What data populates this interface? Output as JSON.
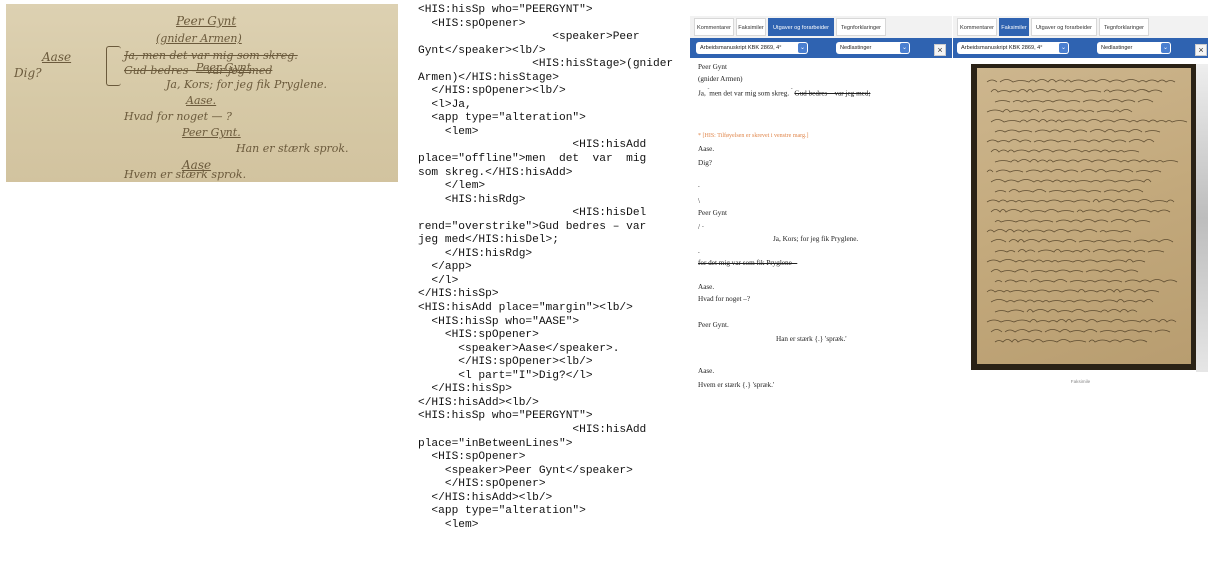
{
  "manuscript": {
    "lines": [
      {
        "text": "Peer Gynt",
        "style": "ul"
      },
      {
        "text": "(gnider Armen)",
        "style": "ul"
      },
      {
        "text": "Aase",
        "style": "ul"
      },
      {
        "text": "Ja, men det var mig som skreg.",
        "style": "strike"
      },
      {
        "text": "Dig?",
        "style": ""
      },
      {
        "text": "Gud bedres — var jeg med",
        "style": "strike"
      },
      {
        "text": "Peer Gynt",
        "style": "ul"
      },
      {
        "text": "Ja, Kors; for jeg fik Pryglene.",
        "style": ""
      },
      {
        "text": "Aase.",
        "style": "ul"
      },
      {
        "text": "Hvad for noget — ?",
        "style": ""
      },
      {
        "text": "Peer Gynt.",
        "style": "ul"
      },
      {
        "text": "Han er stærk sprok.",
        "style": ""
      },
      {
        "text": "Aase",
        "style": "ul"
      },
      {
        "text": "Hvem er stærk sprok.",
        "style": ""
      }
    ]
  },
  "xml_lines": [
    "<HIS:hisSp who=\"PEERGYNT\">",
    "  <HIS:spOpener>",
    "                    <speaker>Peer",
    "Gynt</speaker><lb/>",
    "                 <HIS:hisStage>(gnider",
    "Armen)</HIS:hisStage>",
    "  </HIS:spOpener><lb/>",
    "  <l>Ja,",
    "  <app type=\"alteration\">",
    "    <lem>",
    "                       <HIS:hisAdd",
    "place=\"offline\">men  det  var  mig",
    "som skreg.</HIS:hisAdd>",
    "    </lem>",
    "    <HIS:hisRdg>",
    "                       <HIS:hisDel",
    "rend=\"overstrike\">Gud bedres – var",
    "jeg med</HIS:hisDel>;",
    "    </HIS:hisRdg>",
    "  </app>",
    "  </l>",
    "</HIS:hisSp>",
    "<HIS:hisAdd place=\"margin\"><lb/>",
    "  <HIS:hisSp who=\"AASE\">",
    "    <HIS:spOpener>",
    "      <speaker>Aase</speaker>.",
    "      </HIS:spOpener><lb/>",
    "      <l part=\"I\">Dig?</l>",
    "  </HIS:hisSp>",
    "</HIS:hisAdd><lb/>",
    "<HIS:hisSp who=\"PEERGYNT\">",
    "                       <HIS:hisAdd",
    "place=\"inBetweenLines\">",
    "  <HIS:spOpener>",
    "    <speaker>Peer Gynt</speaker>",
    "    </HIS:spOpener>",
    "  </HIS:hisAdd><lb/>",
    "  <app type=\"alteration\">",
    "    <lem>"
  ],
  "text_panel": {
    "tabs": [
      "Kommentarer",
      "Faksimiler",
      "Utgaver og forarbeider",
      "Tegnforklaringer"
    ],
    "active_tab": 2,
    "select_version": "Arbeidsmanuskript KBK 2869, 4°",
    "select_download": "Nedlastinger",
    "close": "×",
    "lines": [
      "Peer Gynt",
      "(gnider Armen)",
      "Ja,",
      "men det var mig som skreg.",
      "Gud bedres – var jeg med;",
      "[HIS: Tilføyelsen er skrevet i venstre marg.]",
      "Aase.",
      "Dig?",
      ".",
      "\\",
      "Peer Gynt",
      "/ ·",
      "Ja, Kors; for jeg fik Pryglene.",
      ".",
      "for det mig var som fik Pryglene –",
      "Aase.",
      "Hvad for noget –?",
      "Peer Gynt.",
      "Han er stærk {.} 'spræk.'",
      "Aase.",
      "Hvem er stærk {.} 'spræk.'"
    ],
    "marks": {
      "caret": "ˆ",
      "sup": "*"
    }
  },
  "facs_panel": {
    "tabs": [
      "Kommentarer",
      "Faksimiler",
      "Utgaver og forarbeider",
      "Tegnforklaringer"
    ],
    "active_tab": 1,
    "select_version": "Arbeidsmanuskript KBK 2869, 4°",
    "select_download": "Nedlastinger",
    "close": "×",
    "caption": "Faksimile"
  },
  "colors": {
    "accent": "#2f63b1",
    "note": "#e0864b",
    "paper": "#d6c9a6"
  }
}
